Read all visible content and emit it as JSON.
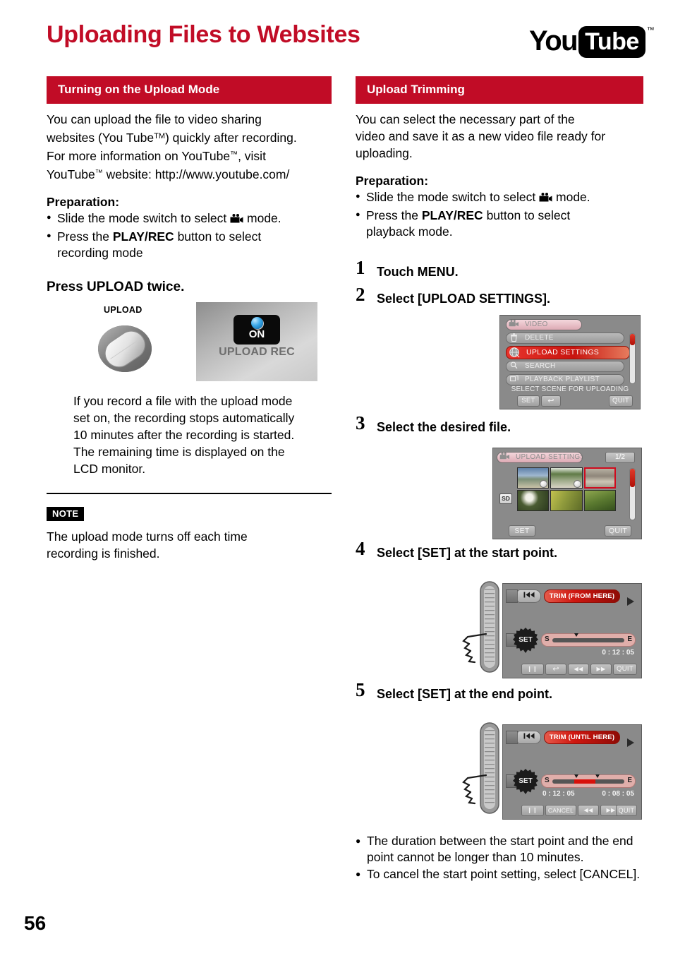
{
  "page": {
    "title": "Uploading Files to Websites",
    "number": "56",
    "brand_red": "#c10c26"
  },
  "logo": {
    "you": "You",
    "tube": "Tube",
    "tm": "™",
    "name": "youtube-logo"
  },
  "left_column": {
    "section_title": "Turning on the Upload Mode",
    "intro_line1": "You can upload the file to video sharing",
    "intro_line2_a": "websites (You Tube",
    "intro_line2_tm": "TM",
    "intro_line2_b": ") quickly after recording.",
    "intro_line3_a": "For more information on YouTube",
    "intro_line3_tm": "™",
    "intro_line3_b": ", visit",
    "intro_line4_a": "YouTube",
    "intro_line4_tm": "™",
    "intro_line4_b": " website: http://www.youtube.com/",
    "preparation_label": "Preparation:",
    "prep_1_a": "Slide the mode switch to select",
    "prep_1_b": "mode.",
    "prep_2_a": "Press the",
    "prep_2_bold": "PLAY/REC",
    "prep_2_b": "button to select",
    "prep_2_cont": "recording mode",
    "press_upload": "Press UPLOAD twice.",
    "upload_button_label": "UPLOAD",
    "lcd_on": "ON",
    "lcd_upload_rec": "UPLOAD REC",
    "explain_line1": "If you record a file with the upload mode",
    "explain_line2": "set on, the recording stops automatically",
    "explain_line3": "10 minutes after the recording is started.",
    "explain_line4": "The remaining time is displayed on the",
    "explain_line5": "LCD monitor.",
    "note_tag": "NOTE",
    "note_line1": "The upload mode turns off each time",
    "note_line2": "recording is finished."
  },
  "right_column": {
    "section_title": "Upload Trimming",
    "intro_line1": "You can select the necessary part of the",
    "intro_line2": "video and save it as a new video file ready for",
    "intro_line3": "uploading.",
    "preparation_label": "Preparation:",
    "prep_1_a": "Slide the mode switch to select",
    "prep_1_b": "mode.",
    "prep_2_a": "Press the",
    "prep_2_bold": "PLAY/REC",
    "prep_2_b": "button to select",
    "prep_2_cont": "playback mode.",
    "steps": [
      {
        "num": "1",
        "text": "Touch MENU."
      },
      {
        "num": "2",
        "text": "Select [UPLOAD SETTINGS]."
      },
      {
        "num": "3",
        "text": "Select the desired file."
      },
      {
        "num": "4",
        "text": "Select [SET] at the start point."
      },
      {
        "num": "5",
        "text": "Select [SET] at the end point."
      }
    ],
    "notes": [
      "The duration between the start point and the end point cannot be longer than 10 minutes.",
      "To cancel the start point setting, select [CANCEL]."
    ]
  },
  "menu_screen": {
    "header": "VIDEO",
    "items": [
      {
        "label": "DELETE",
        "icon": "trash-icon",
        "highlighted": false
      },
      {
        "label": "UPLOAD SETTINGS",
        "icon": "globe-icon",
        "highlighted": true
      },
      {
        "label": "SEARCH",
        "icon": "magnifier-icon",
        "highlighted": false
      },
      {
        "label": "PLAYBACK PLAYLIST",
        "icon": "playlist-icon",
        "highlighted": false
      }
    ],
    "status": "SELECT SCENE FOR UPLOADING",
    "btn_set": "SET",
    "btn_back": "↩",
    "btn_quit": "QUIT"
  },
  "file_screen": {
    "header": "UPLOAD SETTINGS",
    "page_indicator": "1/2",
    "media_badge": "SD",
    "btn_set": "SET",
    "btn_quit": "QUIT",
    "thumbnails": [
      {
        "name": "thumb-beach",
        "selected": false,
        "upload_mark": true
      },
      {
        "name": "thumb-river",
        "selected": false,
        "upload_mark": true
      },
      {
        "name": "thumb-castle",
        "selected": true,
        "upload_mark": false
      },
      {
        "name": "thumb-flower",
        "selected": false,
        "upload_mark": false
      },
      {
        "name": "thumb-grass",
        "selected": false,
        "upload_mark": false
      },
      {
        "name": "thumb-leaves",
        "selected": false,
        "upload_mark": false
      }
    ]
  },
  "trim_start_screen": {
    "banner": "TRIM (FROM HERE)",
    "set_label": "SET",
    "seek_start": "S",
    "seek_end": "E",
    "time_current": "0 : 12 : 05",
    "btn_pause": "❙❙",
    "btn_back": "↩",
    "btn_rew": "◀◀",
    "btn_ffw": "▶▶",
    "btn_quit": "QUIT"
  },
  "trim_end_screen": {
    "banner": "TRIM (UNTIL HERE)",
    "set_label": "SET",
    "seek_start": "S",
    "seek_end": "E",
    "time_start": "0 : 12 : 05",
    "time_end": "0 : 08 : 05",
    "btn_pause": "❙❙",
    "btn_cancel": "CANCEL",
    "btn_rew": "◀◀",
    "btn_ffw": "▶▶",
    "btn_quit": "QUIT"
  }
}
